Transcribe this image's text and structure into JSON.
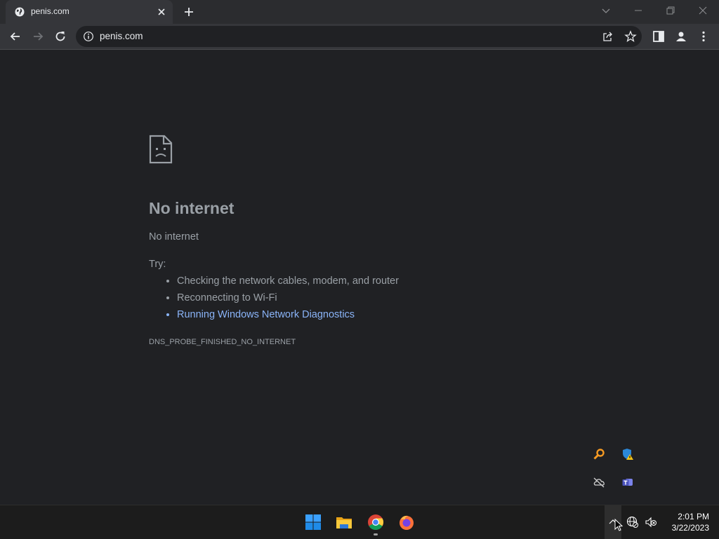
{
  "tab": {
    "title": "penis.com"
  },
  "omnibox": {
    "url": "penis.com"
  },
  "error": {
    "headline": "No internet",
    "subtext": "No internet",
    "try_label": "Try:",
    "suggestions": [
      "Checking the network cables, modem, and router",
      "Reconnecting to Wi-Fi",
      "Running Windows Network Diagnostics"
    ],
    "code": "DNS_PROBE_FINISHED_NO_INTERNET"
  },
  "taskbar": {
    "apps": [
      "start-icon",
      "file-explorer-icon",
      "chrome-icon",
      "firefox-icon"
    ],
    "clock": {
      "time": "2:01 PM",
      "date": "3/22/2023"
    }
  },
  "colors": {
    "link": "#8ab4f8",
    "background": "#202124",
    "text": "#9aa0a6"
  }
}
